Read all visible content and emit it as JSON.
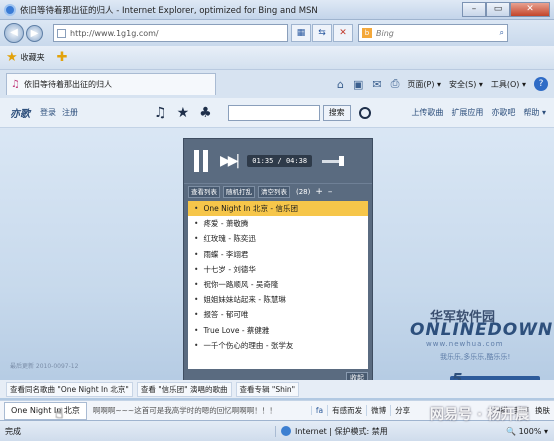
{
  "window": {
    "title": "依旧等待着那出征的归人 - Internet Explorer, optimized for Bing and MSN",
    "min": "–",
    "max": "▭",
    "close": "✕"
  },
  "address": {
    "url": "http://www.1g1g.com/",
    "search_placeholder": "Bing"
  },
  "favorites": {
    "label": "收藏夹"
  },
  "tab": {
    "label": "依旧等待着那出征的归人"
  },
  "commands": {
    "page": "页面(P) ▾",
    "safety": "安全(S) ▾",
    "tools": "工具(O) ▾",
    "help": "?"
  },
  "site": {
    "logo": "亦歌",
    "login": "登录",
    "register": "注册",
    "search_button": "搜索",
    "right_links": [
      "上传歌曲",
      "扩展应用",
      "亦歌吧",
      "帮助 ▾"
    ]
  },
  "player": {
    "time": "01:35 / 04:38",
    "list_tools": [
      "查看列表",
      "随机打乱",
      "清空列表"
    ],
    "count": "(28)",
    "close_label": "收起",
    "songs": [
      {
        "title": "One Night In 北京 - 信乐团",
        "active": true
      },
      {
        "title": "疼爱 - 萧敬腾",
        "active": false
      },
      {
        "title": "红玫瑰 - 陈奕迅",
        "active": false
      },
      {
        "title": "雨蝶 - 李翊君",
        "active": false
      },
      {
        "title": "十七岁 - 刘德华",
        "active": false
      },
      {
        "title": "祝你一路顺风 - 吴奇隆",
        "active": false
      },
      {
        "title": "姐姐妹妹站起来 - 陈慧琳",
        "active": false
      },
      {
        "title": "报答 - 郁可唯",
        "active": false
      },
      {
        "title": "True Love - 蔡健雅",
        "active": false
      },
      {
        "title": "一千个伤心的理由 - 张学友",
        "active": false
      }
    ]
  },
  "watermark": {
    "cn": "华军软件园",
    "en": "ONLINEDOWN",
    "url": "www.newhua.com",
    "slogan": "我乐乐,多乐乐,酷乐乐!",
    "badge": "连接新浪微博",
    "five": "5",
    "updated": "最后更新 2010-0097-12"
  },
  "related": [
    "查看同名歌曲 \"One Night In 北京\"",
    "查看 \"信乐团\" 演唱的歌曲",
    "查看专辑 \"Shin\""
  ],
  "bottom": {
    "now_playing": "One Night In 北京",
    "scroll_text": "啊啊啊~~~这首可是我高学时的嗯的回忆啊啊啊！！！",
    "buttons": [
      "fa",
      "有感而发",
      "微博",
      "分享"
    ],
    "right": [
      "扫描",
      "封面",
      "换肤"
    ]
  },
  "status": {
    "done": "完成",
    "zone": "Internet | 保护模式: 禁用",
    "zoom": "🔍 100% ▾"
  },
  "corner_watermark": "网易号 · 杨开晨"
}
